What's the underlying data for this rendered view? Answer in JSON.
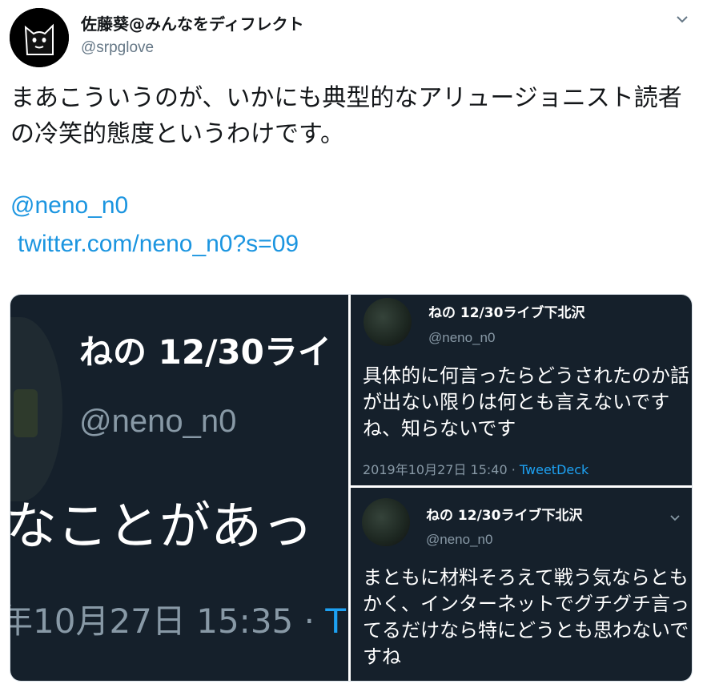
{
  "tweet": {
    "display_name": "佐藤葵@みんなをディフレクト",
    "handle": "@srpglove",
    "text": "まあこういうのが、いかにも典型的なアリュージョニスト読者の冷笑的態度というわけです。",
    "mention_link": "@neno_n0",
    "url_link": "twitter.com/neno_n0?s=09"
  },
  "media": {
    "left": {
      "name": "ねの 12/30ライ",
      "handle": "@neno_n0",
      "text": "なことがあっ",
      "date": "年10月27日 15:35 · ",
      "source": "T"
    },
    "top_right": {
      "name": "ねの 12/30ライブ下北沢",
      "handle": "@neno_n0",
      "text": "具体的に何言ったらどうされたのか話が出ない限りは何とも言えないですね、知らないです",
      "date": "2019年10月27日 15:40 · ",
      "source": "TweetDeck"
    },
    "bottom_right": {
      "name": "ねの 12/30ライブ下北沢",
      "handle": "@neno_n0",
      "text": "まともに材料そろえて戦う気ならともかく、インターネットでグチグチ言ってるだけなら特にどうとも思わないですね"
    }
  },
  "colors": {
    "link": "#1b95e0",
    "dark_bg": "#15202b",
    "secondary_text": "#657786"
  }
}
